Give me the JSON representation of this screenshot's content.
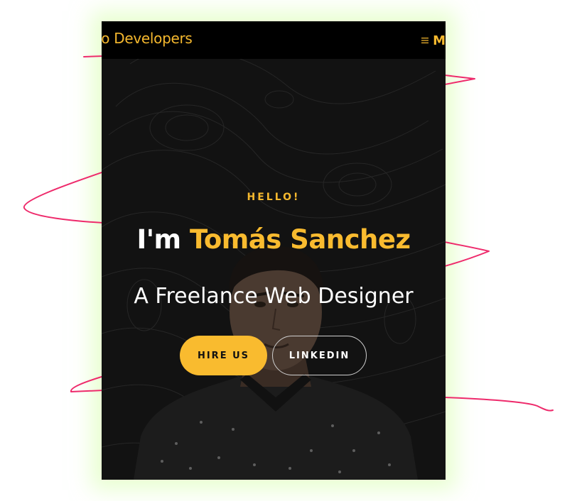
{
  "navbar": {
    "brand": "lo Developers",
    "menu_label": "M",
    "menu_icon": "hamburger-icon"
  },
  "hero": {
    "greeting": "HELLO!",
    "title_prefix": "I'm",
    "title_name": "Tomás Sanchez",
    "subtitle": "A Freelance Web Designer",
    "primary_button": "HIRE US",
    "secondary_button": "LINKEDIN"
  },
  "colors": {
    "accent": "#f9bb2f",
    "background": "#121212",
    "navbar": "#000000",
    "annotation": "#ee2a6b"
  }
}
